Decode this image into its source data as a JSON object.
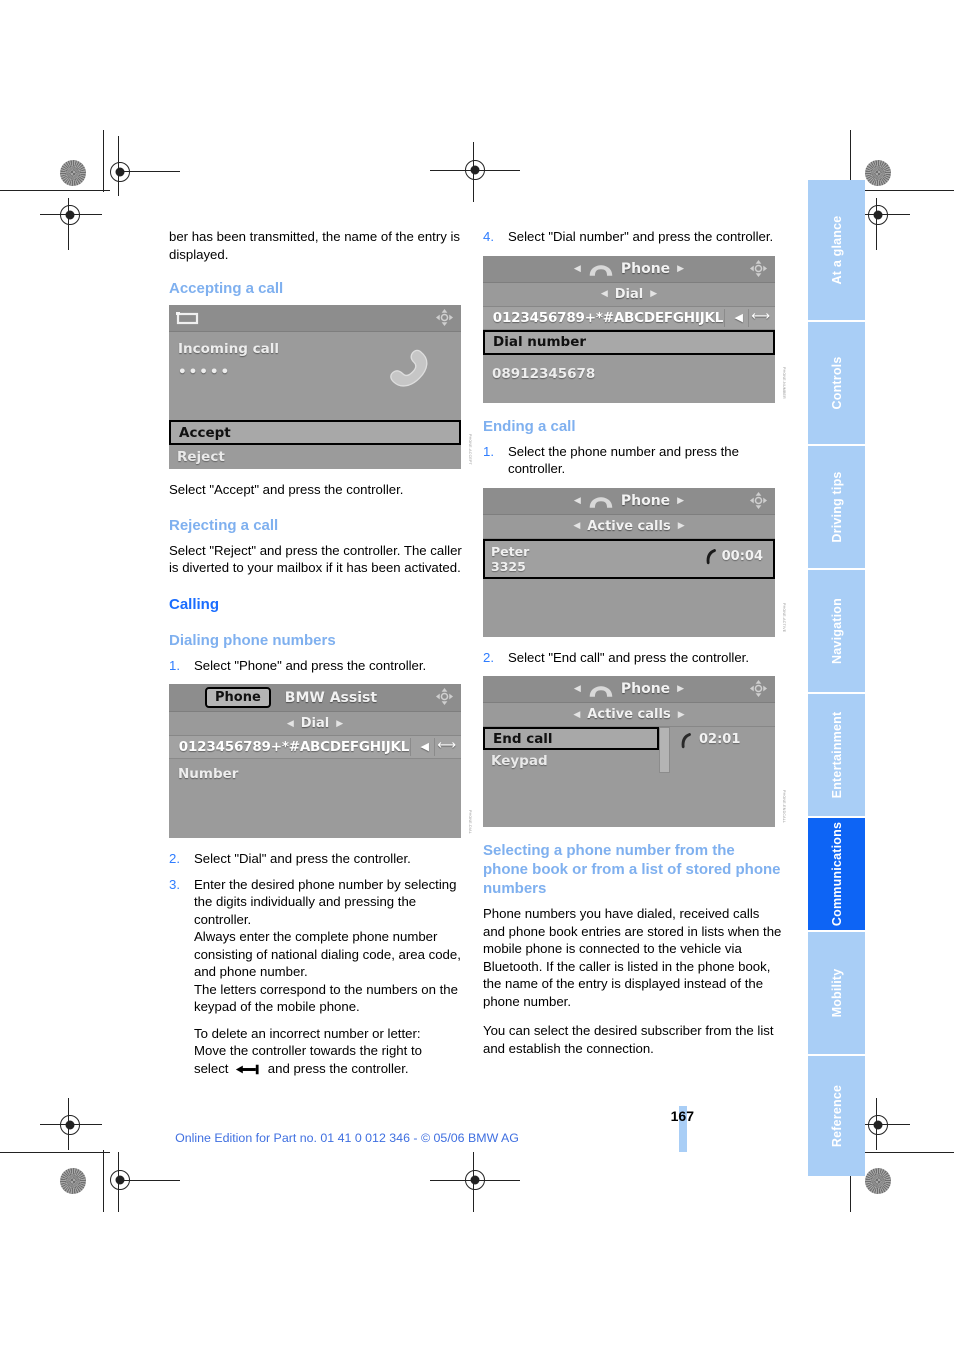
{
  "document": {
    "page_number": "167",
    "footer": "Online Edition for Part no. 01 41 0 012 346 - © 05/06 BMW AG"
  },
  "left_column": {
    "intro": "ber has been transmitted, the name of the entry is displayed.",
    "accepting_heading": "Accepting a call",
    "accepting_caption": "Select \"Accept\" and press the controller.",
    "rejecting_heading": "Rejecting a call",
    "rejecting_body": "Select \"Reject\" and press the controller. The caller is diverted to your mailbox if it has been activated.",
    "calling_heading": "Calling",
    "dialing_heading": "Dialing phone numbers",
    "steps": [
      {
        "num": "1.",
        "text": "Select \"Phone\" and press the controller."
      },
      {
        "num": "2.",
        "text": "Select \"Dial\" and press the controller."
      },
      {
        "num": "3.",
        "text": "Enter the desired phone number by selecting the digits individually and pressing the controller.\nAlways enter the complete phone number consisting of national dialing code, area code, and phone number.\nThe letters correspond to the numbers on the keypad of the mobile phone."
      }
    ],
    "delete_note_a": "To delete an incorrect number or letter:",
    "delete_note_b": "Move the controller towards the right to",
    "delete_note_c": "select",
    "delete_note_d": "and press the controller."
  },
  "right_column": {
    "step4": {
      "num": "4.",
      "text": "Select \"Dial number\" and press the controller."
    },
    "ending_heading": "Ending a call",
    "ending_step1": {
      "num": "1.",
      "text": "Select the phone number and press the controller."
    },
    "ending_step2": {
      "num": "2.",
      "text": "Select \"End call\" and press the controller."
    },
    "selecting_heading": "Selecting a phone number from the phone book or from a list of stored phone numbers",
    "selecting_body1": "Phone numbers you have dialed, received calls and phone book entries are stored in lists when the mobile phone is connected to the vehicle via Bluetooth. If the caller is listed in the phone book, the name of the entry is displayed instead of the phone number.",
    "selecting_body2": "You can select the desired subscriber from the list and establish the connection."
  },
  "screens": {
    "incoming_call": {
      "title": "Incoming call",
      "masked_number": "•••••",
      "accept_label": "Accept",
      "reject_label": "Reject",
      "back_icon": "back-arrow-icon",
      "joystick_icon": "controller-icon",
      "handset_icon": "handset-icon"
    },
    "phone_dial": {
      "tab_phone": "Phone",
      "tab_assist": "BMW Assist",
      "submenu": "Dial",
      "alphabet": "0123456789+*#ABCDEFGHIJKL",
      "field_label": "Number",
      "left_arrow_icon": "left-arrow-icon",
      "backspace_icon": "backspace-icon"
    },
    "dial_number": {
      "title": "Phone",
      "submenu": "Dial",
      "alphabet": "0123456789+*#ABCDEFGHIJKL",
      "selected_item": "Dial number",
      "entered_number": "08912345678"
    },
    "active_call": {
      "title": "Phone",
      "submenu": "Active calls",
      "caller_name": "Peter",
      "caller_ext": "3325",
      "duration": "00:04"
    },
    "end_call": {
      "title": "Phone",
      "submenu": "Active calls",
      "item_end": "End call",
      "item_keypad": "Keypad",
      "duration": "02:01"
    }
  },
  "rail": {
    "tabs": [
      {
        "label": "At a glance",
        "active": false
      },
      {
        "label": "Controls",
        "active": false
      },
      {
        "label": "Driving tips",
        "active": false
      },
      {
        "label": "Navigation",
        "active": false
      },
      {
        "label": "Entertainment",
        "active": false
      },
      {
        "label": "Communications",
        "active": true
      },
      {
        "label": "Mobility",
        "active": false
      },
      {
        "label": "Reference",
        "active": false
      }
    ]
  },
  "colors": {
    "heading_primary": "#1a6dff",
    "heading_secondary": "#7fb0ef",
    "tab_inactive": "#a9cef6",
    "tab_active": "#0d64f5",
    "footer_text": "#3f6fe0"
  }
}
